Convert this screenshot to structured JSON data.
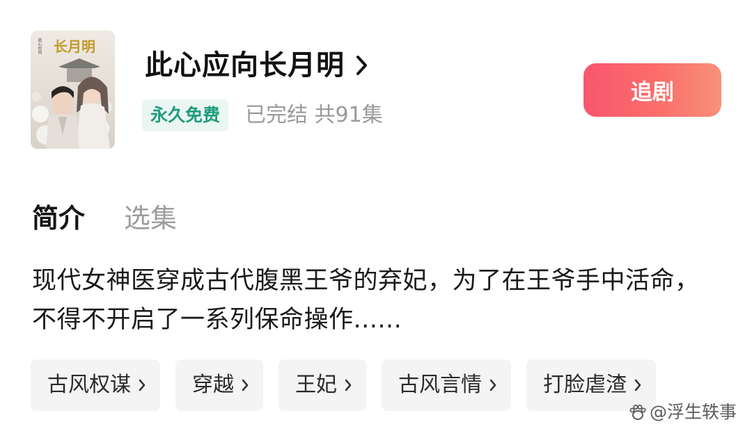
{
  "header": {
    "title": "此心应向长月明",
    "free_badge": "永久免费",
    "status": "已完结 共91集",
    "follow_label": "追剧",
    "poster_title": "长月明",
    "poster_subtitle": "此心应向"
  },
  "tabs": [
    {
      "label": "简介",
      "active": true
    },
    {
      "label": "选集",
      "active": false
    }
  ],
  "description": "现代女神医穿成古代腹黑王爷的弃妃，为了在王爷手中活命，不得不开启了一系列保命操作......",
  "tags": [
    {
      "label": "古风权谋"
    },
    {
      "label": "穿越"
    },
    {
      "label": "王妃"
    },
    {
      "label": "古风言情"
    },
    {
      "label": "打脸虐渣"
    }
  ],
  "watermark": {
    "text": "@浮生轶事",
    "icon": "paw-icon"
  },
  "colors": {
    "accent_gradient_start": "#f9566f",
    "accent_gradient_end": "#f7917a",
    "free_badge_text": "#1f9c7d",
    "free_badge_bg": "#eaf6f2",
    "muted_text": "#9a9a9a",
    "tag_bg": "#f4f4f4"
  }
}
